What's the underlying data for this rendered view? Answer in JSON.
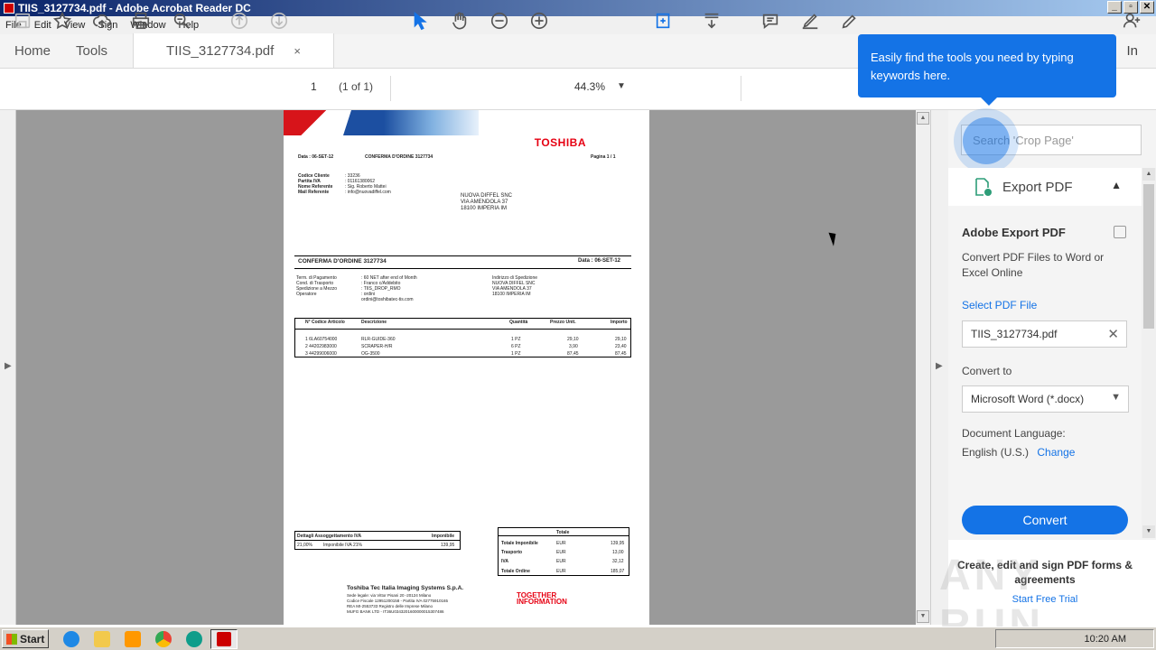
{
  "window": {
    "title": "TIIS_3127734.pdf - Adobe Acrobat Reader DC",
    "buttons": [
      "_",
      "▫",
      "✕"
    ]
  },
  "menu": [
    "File",
    "Edit",
    "View",
    "Sign",
    "Window",
    "Help"
  ],
  "tabs": {
    "home": "Home",
    "tools": "Tools",
    "doc": "TIIS_3127734.pdf",
    "close": "×",
    "signin": "In"
  },
  "toolbar": {
    "page_input": "1",
    "page_info": "(1 of 1)",
    "zoom": "44.3%"
  },
  "tooltip": "Easily find the tools you need by typing keywords here.",
  "panel": {
    "search_placeholder": "Search 'Crop Page'",
    "export_header": "Export PDF",
    "title": "Adobe Export PDF",
    "desc": "Convert PDF Files to Word or Excel Online",
    "select_link": "Select PDF File",
    "file": "TIIS_3127734.pdf",
    "convert_to_label": "Convert to",
    "convert_to_value": "Microsoft Word (*.docx)",
    "lang_label": "Document Language:",
    "lang_value": "English (U.S.)",
    "change": "Change",
    "convert_btn": "Convert",
    "promo_title": "Create, edit and sign PDF forms & agreements",
    "promo_link": "Start Free Trial"
  },
  "document": {
    "brand": "TOSHIBA",
    "date_top": "Data : 06-SET-12",
    "conf_top": "CONFERMA D'ORDINE 3127734",
    "page_top": "Pagina  1 / 1",
    "client_labels": [
      "Codice Cliente",
      "Partita IVA",
      "Nome Referente",
      "Mail Referente"
    ],
    "client_values": [
      ": 33236",
      ": 01161380062",
      ": Sig. Roberto Mattei",
      ": info@nuovadiffel.com"
    ],
    "address": [
      "NUOVA DIFFEL SNC",
      "VIA AMENDOLA 37",
      "18100 IMPERIA IM"
    ],
    "heading": "CONFERMA D'ORDINE 3127734",
    "heading_date": "Data : 06-SET-12",
    "terms_labels": [
      "Term. di Pagamento",
      "Cond. di Trasporto",
      "Spedizione a Mezzo",
      "Operatore"
    ],
    "terms_values": [
      ": 60 NET after end of Month",
      ": Franco c/Addebito",
      ": TIIS_DROP_RMO",
      ": ordini",
      "  ordini@toshibatec-tis.com"
    ],
    "ship_label": "Indirizzo di Spedizione",
    "ship_address": [
      "NUOVA DIFFEL SNC",
      "VIA AMENDOLA 37",
      "18100 IMPERIA IM"
    ],
    "table_headers": [
      "N° Codice Articolo",
      "Descrizione",
      "Quantità",
      "Prezzo Unit.",
      "Importo"
    ],
    "rows": [
      [
        "1  6LA60754000",
        "RLR-GUIDE-360",
        "1 PZ",
        "29,10",
        "29,10"
      ],
      [
        "2  44202983000",
        "SCRAPER-H/R",
        "6 PZ",
        "3,90",
        "23,40"
      ],
      [
        "3  44299006000",
        "OG-3500",
        "1 PZ",
        "87,45",
        "87,45"
      ]
    ],
    "iva_header": "Dettagli Assoggettamento IVA",
    "iva_header2": "Imponibile",
    "iva_row": [
      "21,00%",
      "Imponibile IVA 21%",
      "139,95"
    ],
    "totals_header": "Totale",
    "totals": [
      [
        "Totale Imponibile",
        "EUR",
        "139,95"
      ],
      [
        "Trasporto",
        "EUR",
        "13,00"
      ],
      [
        "IVA",
        "EUR",
        "32,12"
      ],
      [
        "Totale Ordine",
        "EUR",
        "185,07"
      ]
    ],
    "footer_company": "Toshiba Tec Italia Imaging Systems S.p.A.",
    "footer_lines": [
      "Sede legale: via Vittor Pisani 20 -20124 Milano",
      "Codice Fiscale 12951200158 - Partita IVA 02775910165",
      "REA MI-2553733 Registro delle Imprese Milano",
      "MUFG BANK LTD - IT36U0343201600000015307486"
    ],
    "together": [
      "TOGETHER",
      "INFORMATION"
    ]
  },
  "taskbar": {
    "start": "Start",
    "clock": "10:20 AM"
  },
  "watermark": "ANY RUN"
}
